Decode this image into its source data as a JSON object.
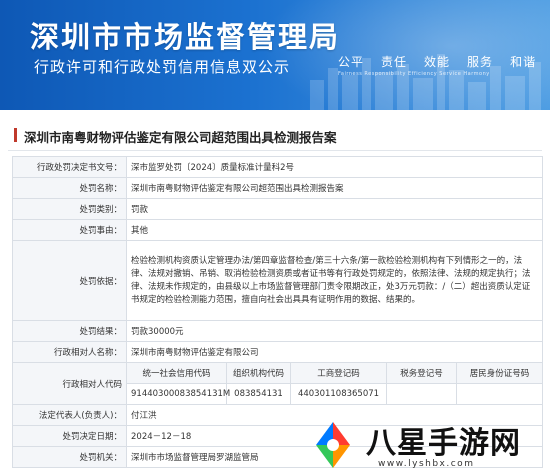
{
  "header": {
    "site_title": "深圳市市场监督管理局",
    "site_subtitle": "行政许可和行政处罚信用信息双公示",
    "slogans": [
      "公平",
      "责任",
      "效能",
      "服务",
      "和谐"
    ],
    "slogan_en": "Fairness Responsibility Efficiency Service Harmony"
  },
  "page_title": "深圳市南粤财物评估鉴定有限公司超范围出具检测报告案",
  "rows": {
    "doc_no": {
      "label": "行政处罚决定书文号：",
      "value": "深市监罗处罚〔2024〕质量标准计量科2号"
    },
    "case_name": {
      "label": "处罚名称：",
      "value": "深圳市南粤财物评估鉴定有限公司超范围出具检测报告案"
    },
    "category": {
      "label": "处罚类别：",
      "value": "罚款"
    },
    "reason_type": {
      "label": "处罚事由：",
      "value": "其他"
    },
    "basis": {
      "label": "处罚依据：",
      "value": "检验检测机构资质认定管理办法/第四章监督检查/第三十六条/第一款检验检测机构有下列情形之一的，法律、法规对撤销、吊销、取消检验检测资质或者证书等有行政处罚规定的，依照法律、法规的规定执行；法律、法规未作规定的，由县级以上市场监督管理部门责令限期改正，处3万元罚款：/（二）超出资质认定证书规定的检验检测能力范围，擅自向社会出具具有证明作用的数据、结果的。"
    },
    "result": {
      "label": "处罚结果：",
      "value": "罚款30000元"
    },
    "party": {
      "label": "行政相对人名称：",
      "value": "深圳市南粤财物评估鉴定有限公司"
    },
    "codes": {
      "label": "行政相对人代码",
      "headers": [
        "统一社会信用代码",
        "组织机构代码",
        "工商登记码",
        "税务登记号",
        "居民身份证号码"
      ],
      "values": [
        "91440300083854131M",
        "083854131",
        "440301108365071",
        "",
        ""
      ]
    },
    "legal_rep": {
      "label": "法定代表人(负责人)：",
      "value": "付江洪"
    },
    "decision_date": {
      "label": "处罚决定日期：",
      "value": "2024－12－18"
    },
    "authority": {
      "label": "处罚机关：",
      "value": "深圳市市场监督管理局罗湖监管局"
    }
  },
  "watermark": {
    "text": "八星手游网",
    "url": "www.lyshbx.com"
  },
  "colors": {
    "banner": "#1b71d0",
    "title_accent": "#c0392b",
    "label_bg": "#f4f6f9"
  }
}
